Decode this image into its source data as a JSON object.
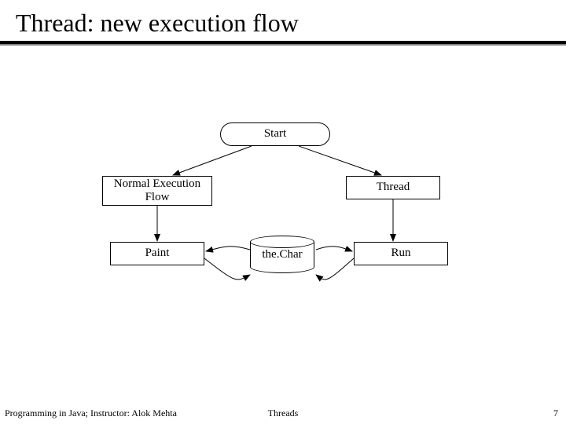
{
  "title": "Thread: new execution flow",
  "nodes": {
    "start": "Start",
    "normal": "Normal Execution\nFlow",
    "thread": "Thread",
    "paint": "Paint",
    "thechar": "the.Char",
    "run": "Run"
  },
  "footer": {
    "left": "Programming in Java; Instructor: Alok Mehta",
    "center": "Threads",
    "page": "7"
  }
}
